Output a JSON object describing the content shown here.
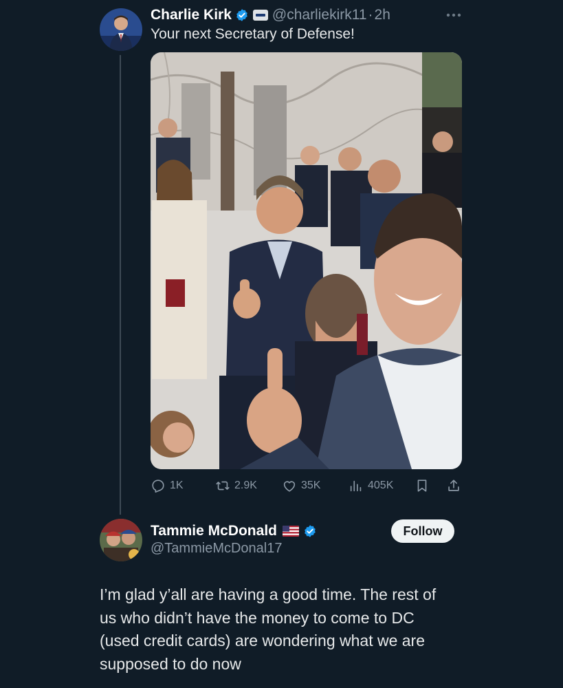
{
  "tweet": {
    "author_name": "Charlie Kirk",
    "author_handle": "@charliekirk11",
    "separator": "·",
    "time": "2h",
    "text": "Your next Secretary of Defense!",
    "avatar_icon": "profile-photo",
    "verified_icon": "verified-badge-icon",
    "affiliation_icon": "affiliate-badge-icon",
    "photo_description": "photo-icon",
    "actions": {
      "replies": "1K",
      "reposts": "2.9K",
      "likes": "35K",
      "views": "405K"
    }
  },
  "reply": {
    "author_name": "Tammie McDonald",
    "author_handle": "@TammieMcDonal17",
    "flag_icon": "us-flag-icon",
    "follow_label": "Follow",
    "text_lines": [
      "I’m glad y’all are having a good time. The rest of",
      "us who didn’t have the money to come to DC",
      "(used credit cards) are wondering what we are",
      "supposed to do now"
    ]
  },
  "colors": {
    "background": "#101c27",
    "text_primary": "#e7e9ea",
    "text_muted": "#8b98a5",
    "verified_blue": "#1d9bf0",
    "follow_bg": "#eff3f4"
  }
}
